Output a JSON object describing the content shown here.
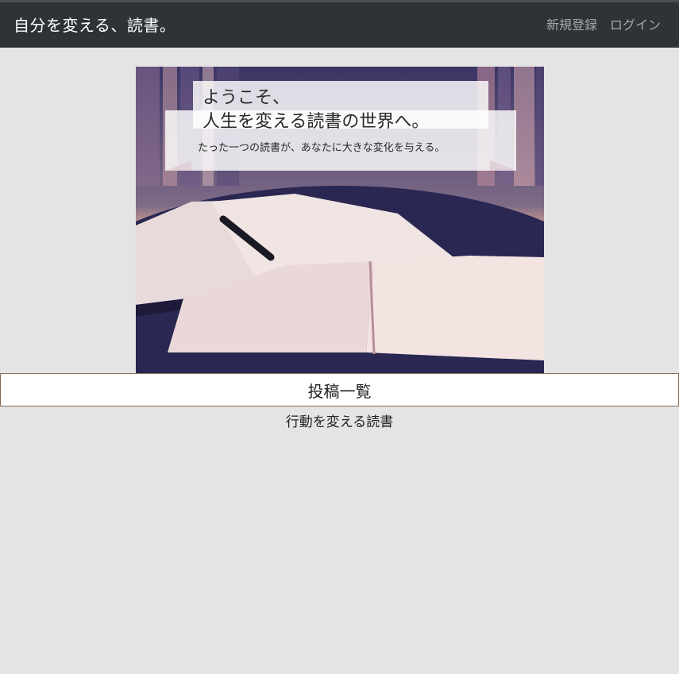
{
  "navbar": {
    "brand": "自分を変える、読書。",
    "links": [
      "新規登録",
      "ログイン"
    ]
  },
  "hero": {
    "line1": "ようこそ、",
    "line2": "人生を変える読書の世界へ。",
    "line3": "たった一つの読書が、あなたに大きな変化を与える。"
  },
  "main": {
    "post_list_button": "投稿一覧",
    "posts": [
      "行動を変える読書"
    ]
  },
  "colors": {
    "navbar_bg": "#2f3338",
    "page_bg": "#e4e4e4",
    "button_border": "#8a6a52"
  }
}
